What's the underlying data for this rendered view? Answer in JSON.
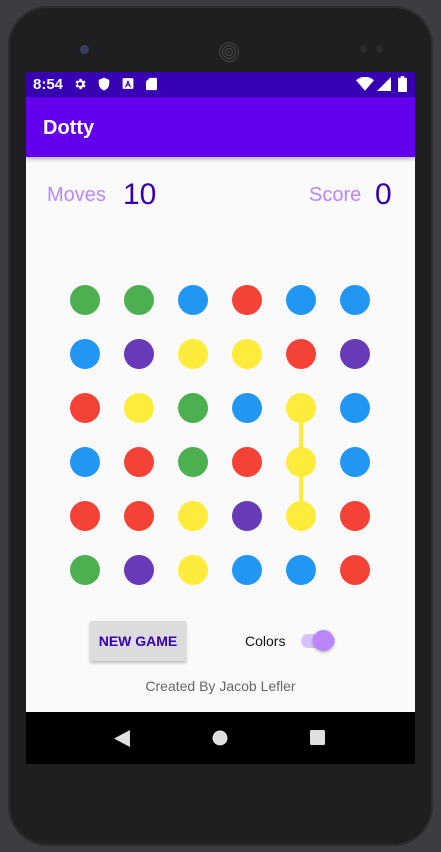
{
  "status_bar": {
    "time": "8:54"
  },
  "app_bar": {
    "title": "Dotty"
  },
  "stats": {
    "moves_label": "Moves",
    "moves_value": "10",
    "score_label": "Score",
    "score_value": "0"
  },
  "colors": {
    "green": "#4caf50",
    "blue": "#2196f3",
    "red": "#f44336",
    "purple": "#673ab7",
    "yellow": "#ffeb3b",
    "accent": "#6200ee",
    "dark_accent": "#3700b3"
  },
  "grid": [
    [
      "green",
      "green",
      "blue",
      "red",
      "blue",
      "blue"
    ],
    [
      "blue",
      "purple",
      "yellow",
      "yellow",
      "red",
      "purple"
    ],
    [
      "red",
      "yellow",
      "green",
      "blue",
      "yellow",
      "blue"
    ],
    [
      "blue",
      "red",
      "green",
      "red",
      "yellow",
      "blue"
    ],
    [
      "red",
      "red",
      "yellow",
      "purple",
      "yellow",
      "red"
    ],
    [
      "green",
      "purple",
      "yellow",
      "blue",
      "blue",
      "red"
    ]
  ],
  "selected_path": [
    [
      2,
      4
    ],
    [
      3,
      4
    ],
    [
      4,
      4
    ]
  ],
  "controls": {
    "new_game_label": "NEW GAME",
    "colors_label": "Colors",
    "colors_toggle_on": true
  },
  "footer": {
    "credit": "Created By Jacob Lefler"
  }
}
